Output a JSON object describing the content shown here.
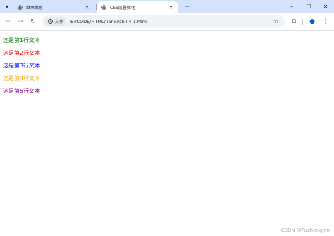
{
  "tabs": [
    {
      "title": "继承关系",
      "active": false
    },
    {
      "title": "CSS层叠优化",
      "active": true
    }
  ],
  "toolbar": {
    "site_label": "文件",
    "url": "E:/CODE/HTML/lianxi/shili4-1.html"
  },
  "icons": {
    "tab_dropdown": "▾",
    "tab_close": "✕",
    "new_tab": "+",
    "minimize": "–",
    "maximize": "☐",
    "close": "✕",
    "back": "←",
    "forward": "→",
    "reload": "↻",
    "info": "i",
    "star": "☆",
    "extensions": "⧉",
    "profile": "●",
    "menu": "⋮"
  },
  "content": {
    "lines": [
      {
        "text": "这是第1行文本",
        "color": "#008000"
      },
      {
        "text": "这是第2行文本",
        "color": "#ff0000"
      },
      {
        "text": "这是第3行文本",
        "color": "#0000ff"
      },
      {
        "text": "这是第4行文本",
        "color": "#ffa500"
      },
      {
        "text": "这是第5行文本",
        "color": "#800080"
      }
    ]
  },
  "watermark": "CSDN @Fuzhengjim"
}
